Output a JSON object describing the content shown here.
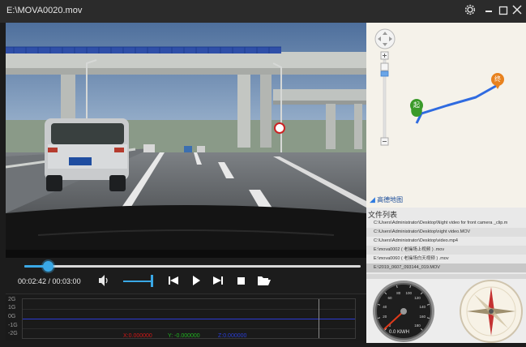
{
  "window": {
    "title": "E:\\MOVA0020.mov"
  },
  "titlebar_icons": [
    "gear-icon",
    "minimize-icon",
    "maximize-icon",
    "close-icon"
  ],
  "player": {
    "time": "00:02:42 / 00:03:00",
    "progress": 0.07,
    "volume": 0.9
  },
  "map": {
    "start_marker": "起",
    "end_marker": "终",
    "brand": "高德地图"
  },
  "file_list": {
    "title": "文件列表",
    "items": [
      "C:\\Users\\Administrator\\Desktop\\Night video for front camera _clip.m",
      "C:\\Users\\Administrator\\Desktop\\night video.MOV",
      "C:\\Users\\Administrator\\Desktop\\video.mp4",
      "E:\\mova0002 ( 老操场上视频 ) .mov",
      "E:\\mova0060 ( 老操场白天视频 ) .mov",
      "E:\\2019_0607_093144_019.MOV"
    ],
    "selected_index": 5
  },
  "gsensor": {
    "y_labels": [
      "2G",
      "1G",
      "0G",
      "-1G",
      "-2G"
    ],
    "readouts": [
      {
        "text": "X:0.000000",
        "color": "#d01818"
      },
      {
        "text": "Y: -0.000000",
        "color": "#21b321"
      },
      {
        "text": "Z:0.000000",
        "color": "#2a3ed6"
      }
    ]
  },
  "speedometer": {
    "reading": "0.0 KM/H",
    "ticks": [
      "0",
      "20",
      "40",
      "60",
      "80",
      "100",
      "120",
      "140",
      "160",
      "180"
    ],
    "speed": 0
  },
  "colors": {
    "accent": "#3aa8e6",
    "route": "#2f6be0",
    "start_pin": "#3a9a2a",
    "end_pin": "#e8821e"
  }
}
